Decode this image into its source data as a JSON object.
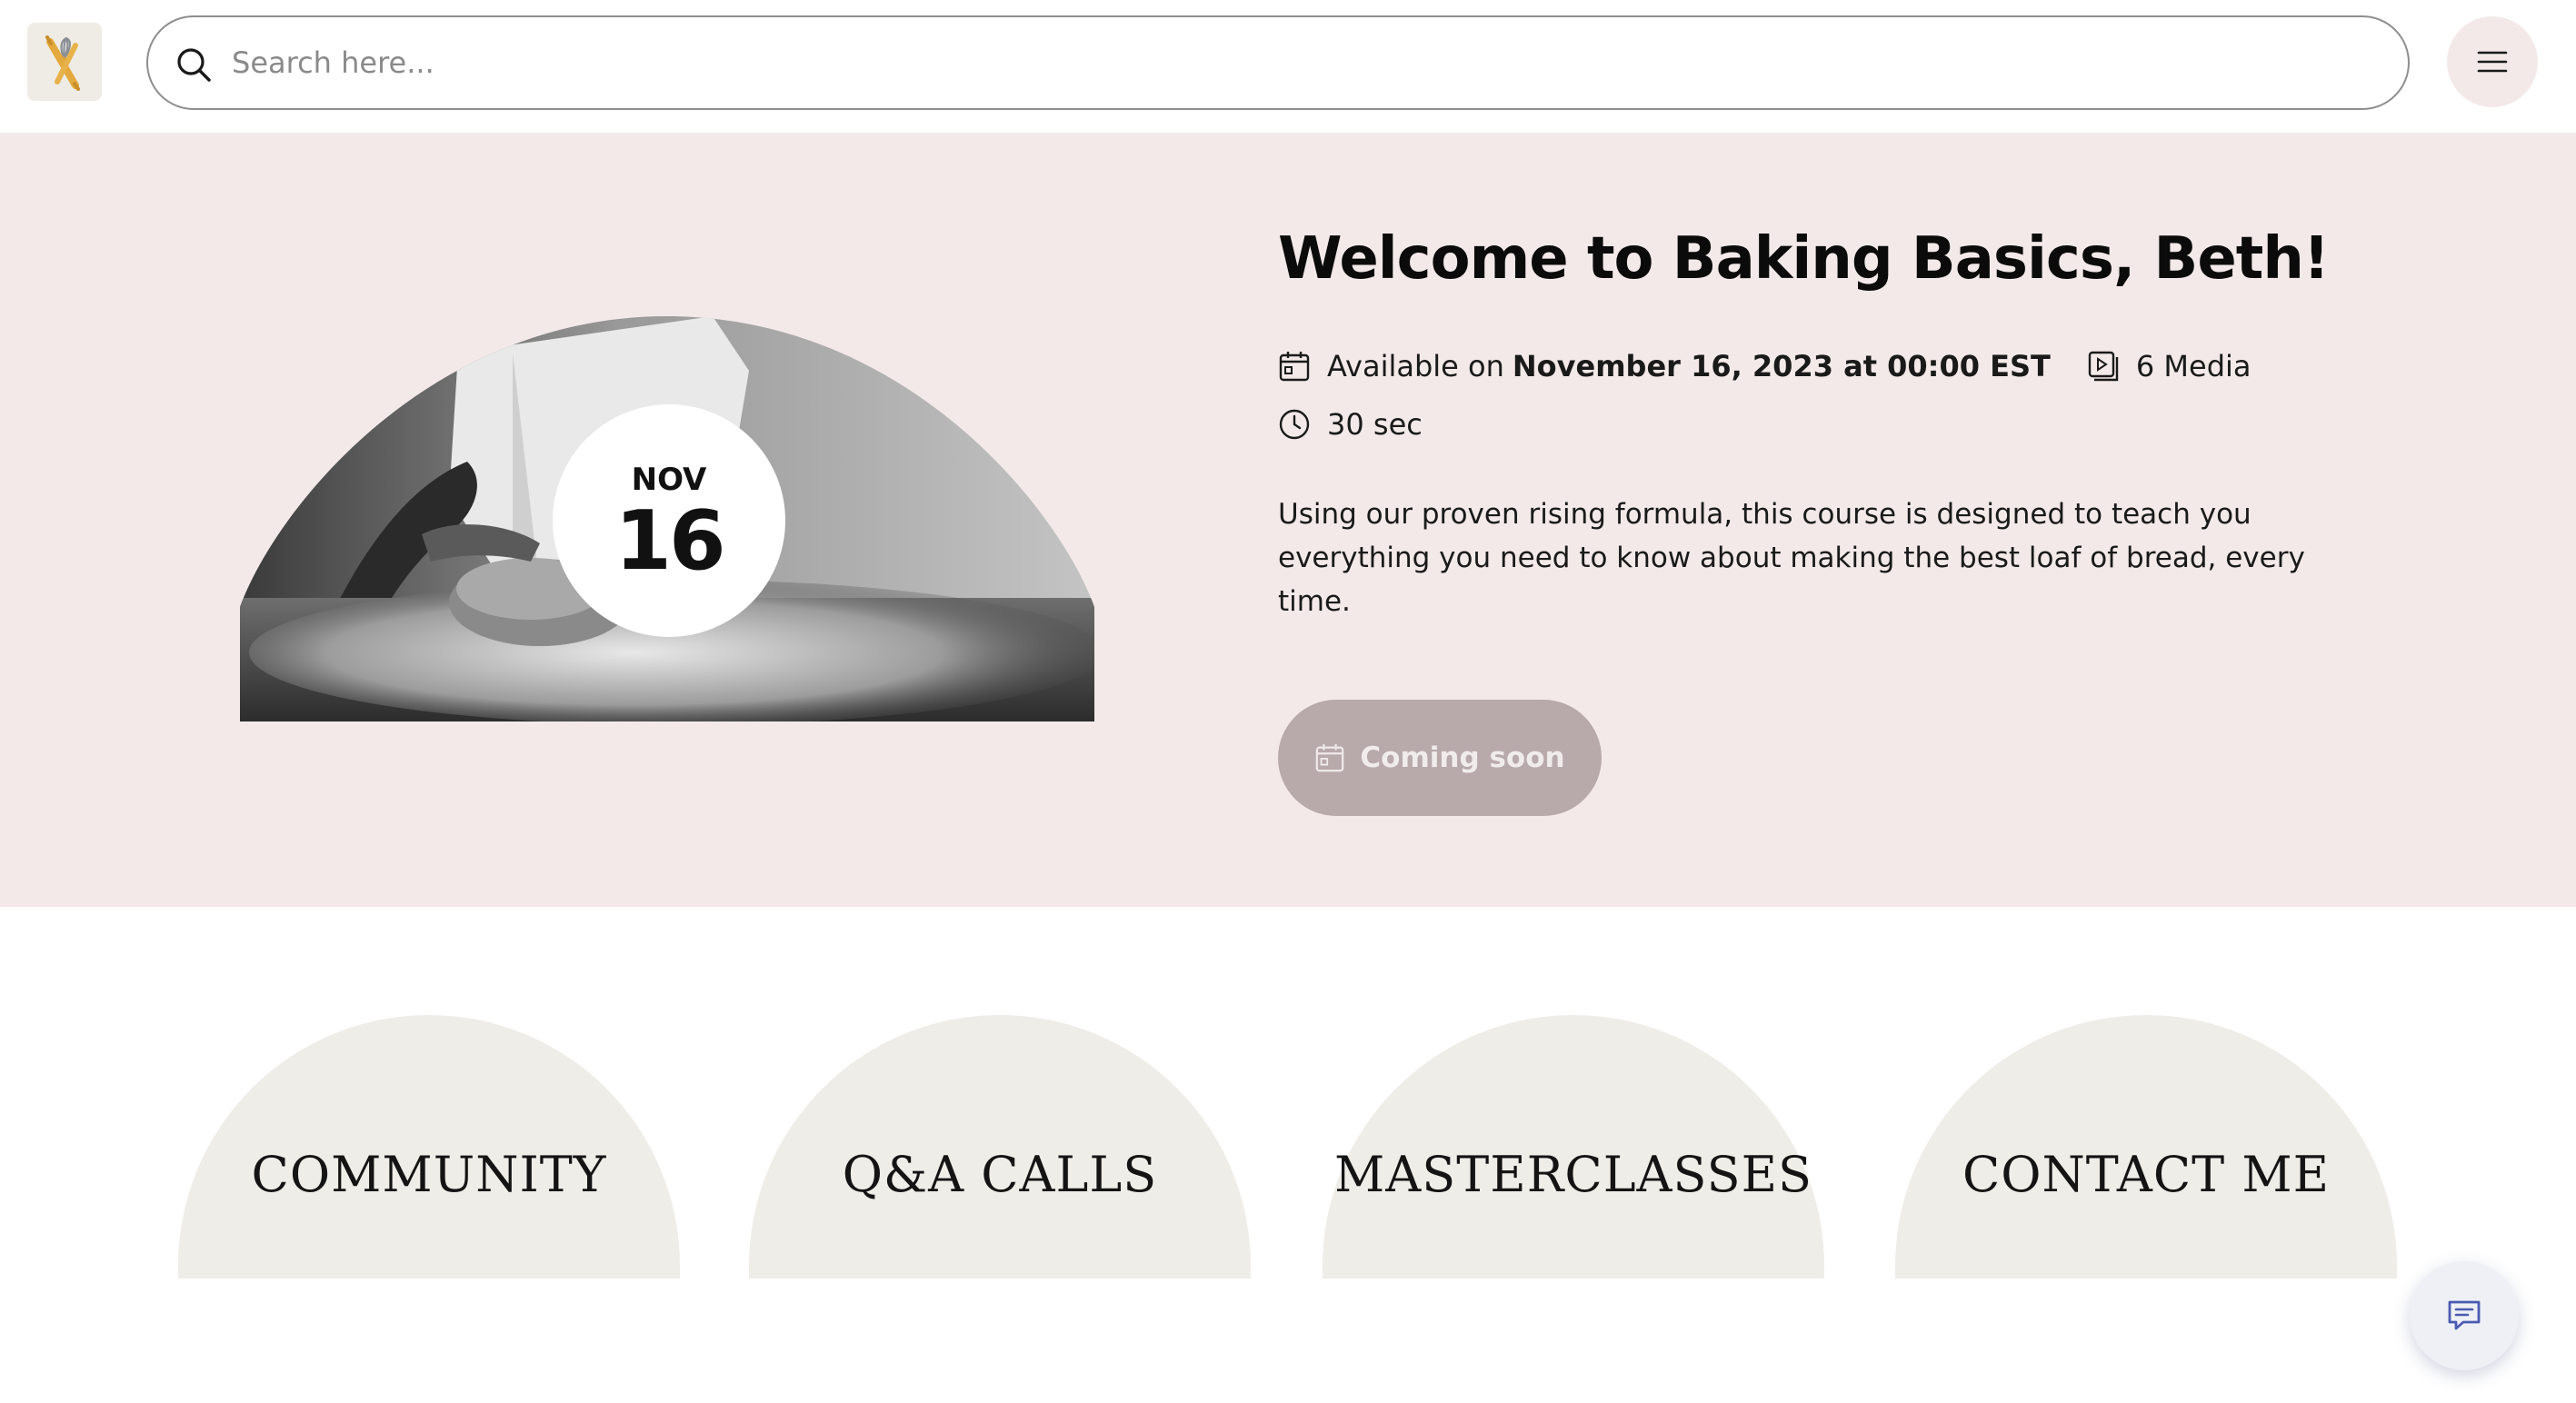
{
  "header": {
    "search_placeholder": "Search here...",
    "logo_icon": "rolling-pin-whisk-logo",
    "menu_icon": "hamburger-menu-icon"
  },
  "hero": {
    "date": {
      "month": "NOV",
      "day": "16"
    },
    "title": "Welcome to Baking Basics, Beth!",
    "available_prefix": "Available on",
    "available_date": "November 16, 2023 at 00:00 EST",
    "media": "6 Media",
    "duration": "30 sec",
    "description": "Using our proven rising formula, this course is designed to teach you everything you need to know about making the best loaf of bread, every time.",
    "button_label": "Coming soon"
  },
  "nav": {
    "items": [
      {
        "label": "COMMUNITY"
      },
      {
        "label": "Q&A CALLS"
      },
      {
        "label": "MASTERCLASSES"
      },
      {
        "label": "CONTACT ME"
      }
    ]
  },
  "colors": {
    "hero_bg": "#f4e9e9",
    "arch_bg": "#efede8",
    "button_bg": "#b8a9ab",
    "chat_icon": "#4a5bb0"
  }
}
